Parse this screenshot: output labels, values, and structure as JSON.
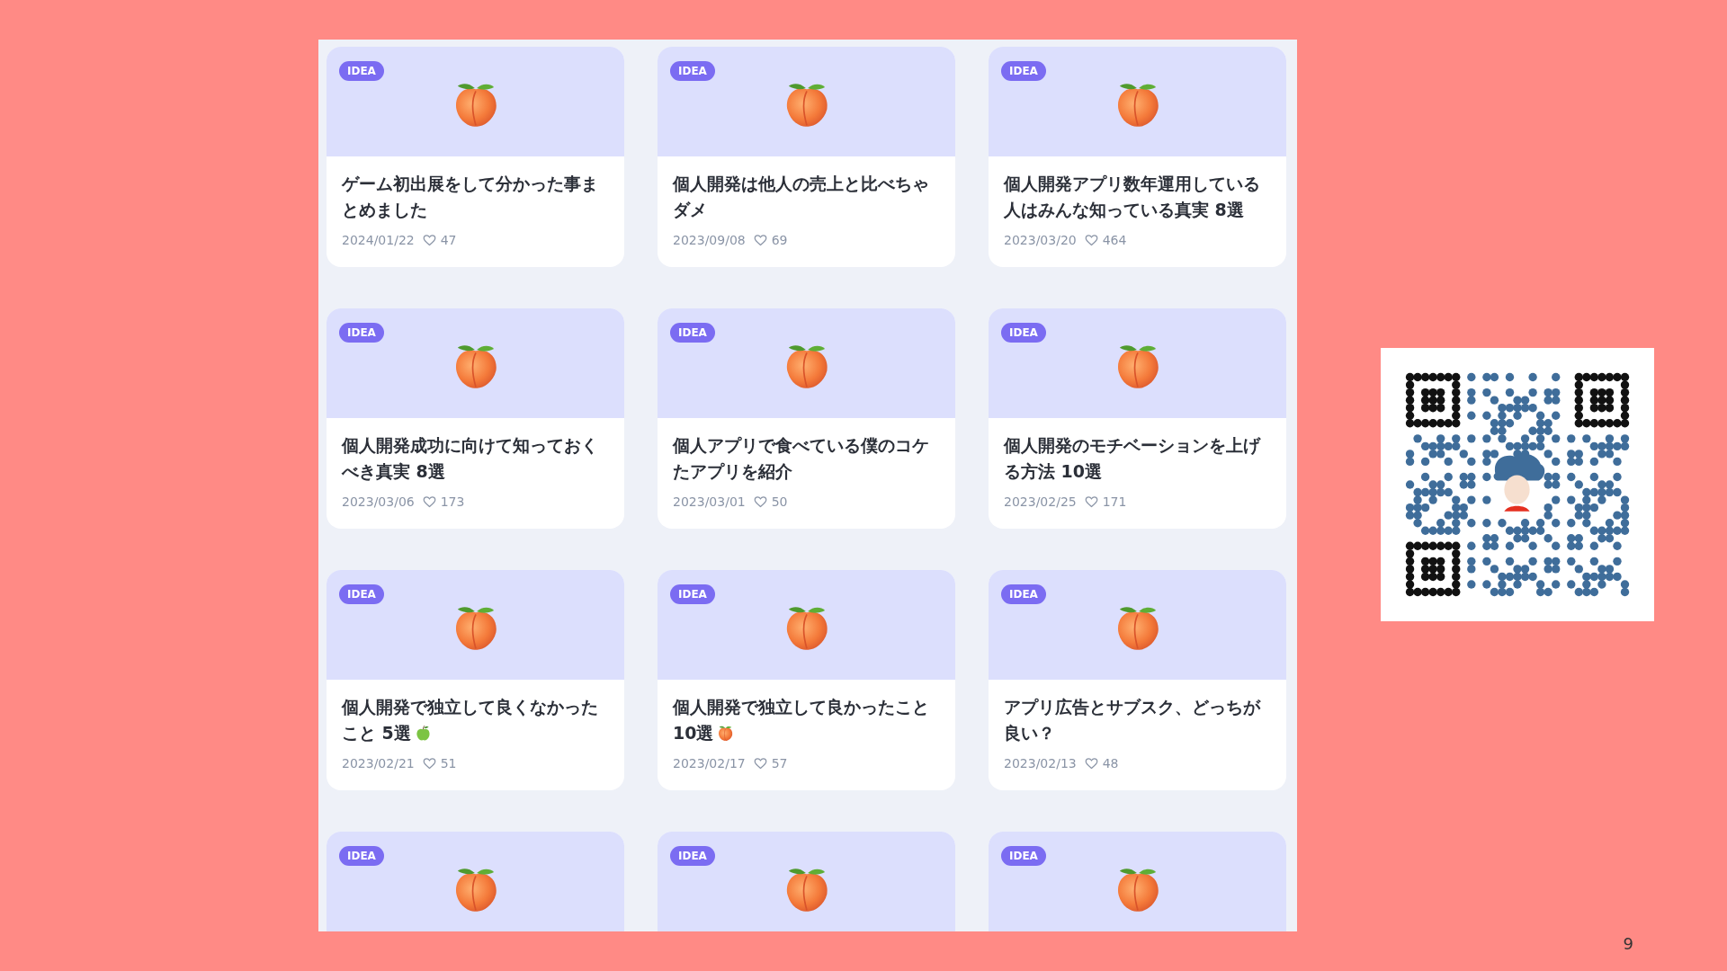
{
  "cards": [
    {
      "kind": "plain",
      "badge": "IDEA",
      "title": "ゲーム初出展をして分かった事まとめました",
      "date": "2024/01/22",
      "likes": "47"
    },
    {
      "kind": "plain",
      "badge": "IDEA",
      "title": "個人開発は他人の売上と比べちゃダメ",
      "date": "2023/09/08",
      "likes": "69"
    },
    {
      "kind": "plain",
      "badge": "IDEA",
      "title": "個人開発アプリ数年運用している人はみんな知っている真実 8選",
      "date": "2023/03/20",
      "likes": "464"
    },
    {
      "kind": "plain",
      "badge": "IDEA",
      "title": "個人開発成功に向けて知っておくべき真実 8選",
      "date": "2023/03/06",
      "likes": "173"
    },
    {
      "kind": "plain",
      "badge": "IDEA",
      "title": "個人アプリで食べている僕のコケたアプリを紹介",
      "date": "2023/03/01",
      "likes": "50"
    },
    {
      "kind": "plain",
      "badge": "IDEA",
      "title": "個人開発のモチベーションを上げる方法 10選",
      "date": "2023/02/25",
      "likes": "171"
    },
    {
      "kind": "apple",
      "badge": "IDEA",
      "title": "個人開発で独立して良くなかったこと 5選",
      "date": "2023/02/21",
      "likes": "51"
    },
    {
      "kind": "peach",
      "badge": "IDEA",
      "title": "個人開発で独立して良かったこと10選",
      "date": "2023/02/17",
      "likes": "57"
    },
    {
      "kind": "plain",
      "badge": "IDEA",
      "title": "アプリ広告とサブスク、どっちが良い？",
      "date": "2023/02/13",
      "likes": "48"
    },
    {
      "kind": "cut",
      "badge": "IDEA"
    },
    {
      "kind": "cut",
      "badge": "IDEA"
    },
    {
      "kind": "cut",
      "badge": "IDEA"
    }
  ],
  "page_number": "9"
}
